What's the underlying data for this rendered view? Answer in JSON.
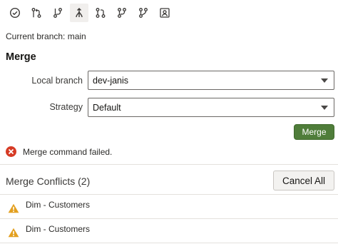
{
  "toolbar": {
    "icons": [
      "check-circle-icon",
      "compare-branches-icon",
      "branch-icon",
      "merge-icon",
      "pull-request-icon",
      "branch-fork-icon",
      "branch-alt-icon",
      "user-badge-icon"
    ],
    "active": "merge-icon"
  },
  "status": {
    "current_branch": "Current branch: main"
  },
  "merge": {
    "title": "Merge",
    "local_branch_label": "Local branch",
    "local_branch_value": "dev-janis",
    "strategy_label": "Strategy",
    "strategy_value": "Default",
    "merge_button": "Merge"
  },
  "error": {
    "message": "Merge command failed."
  },
  "conflicts": {
    "title": "Merge Conflicts (2)",
    "cancel_all": "Cancel All",
    "items": [
      {
        "label": "Dim - Customers"
      },
      {
        "label": "Dim - Customers"
      }
    ]
  },
  "colors": {
    "primary_button": "#4f7d3a",
    "error": "#d63b25",
    "warning": "#e3a020"
  }
}
